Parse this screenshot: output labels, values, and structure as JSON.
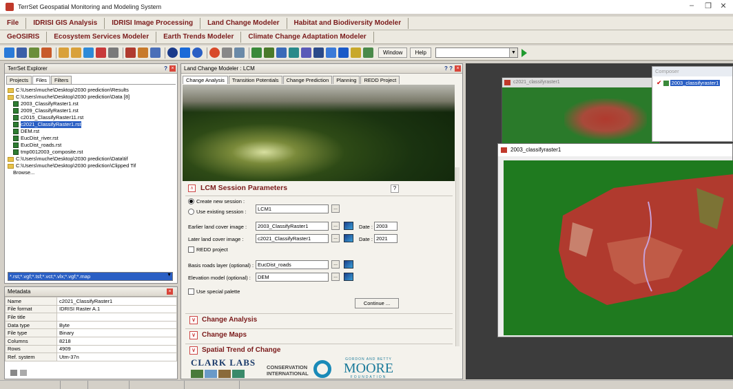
{
  "window": {
    "title": "TerrSet Geospatial Monitoring and Modeling System"
  },
  "menu1": [
    "File",
    "IDRISI GIS Analysis",
    "IDRISI Image Processing",
    "Land Change Modeler",
    "Habitat and Biodiversity Modeler"
  ],
  "menu2": [
    "GeOSIRIS",
    "Ecosystem Services Modeler",
    "Earth Trends Modeler",
    "Climate Change Adaptation Modeler"
  ],
  "toolbar": {
    "window_label": "Window",
    "help_label": "Help"
  },
  "explorer": {
    "title": "TerrSet Explorer",
    "help": "?",
    "tabs": [
      "Projects",
      "Files",
      "Filters"
    ],
    "tree": [
      {
        "icon": "folder",
        "text": "C:\\Users\\muche\\Desktop\\2030 prediction\\Results",
        "indent": 0
      },
      {
        "icon": "folder",
        "text": "C:\\Users\\muche\\Desktop\\2030 prediction\\Data [8]",
        "indent": 0
      },
      {
        "icon": "raster",
        "text": "2003_ClassifyRaster1.rst",
        "indent": 1
      },
      {
        "icon": "raster",
        "text": "2009_ClassifyRaster1.rst",
        "indent": 1
      },
      {
        "icon": "raster",
        "text": "c2015_ClassifyRaster11.rst",
        "indent": 1
      },
      {
        "icon": "raster",
        "text": "c2021_ClassifyRaster1.rst",
        "indent": 1,
        "selected": true
      },
      {
        "icon": "raster",
        "text": "DEM.rst",
        "indent": 1
      },
      {
        "icon": "raster",
        "text": "EucDist_river.rst",
        "indent": 1
      },
      {
        "icon": "raster",
        "text": "EucDist_roads.rst",
        "indent": 1
      },
      {
        "icon": "raster",
        "text": "tmp0012003_composite.rst",
        "indent": 1
      },
      {
        "icon": "folder",
        "text": "C:\\Users\\muche\\Desktop\\2030 prediction\\Data\\tif",
        "indent": 0
      },
      {
        "icon": "folder",
        "text": "C:\\Users\\muche\\Desktop\\2030 prediction\\Clipped Tif",
        "indent": 0
      },
      {
        "icon": "none",
        "text": "Browse...",
        "indent": 1
      }
    ],
    "filter": "*.rst;*.vgf;*.tsf;*.vct;*.vlx;*.vgf;*.map"
  },
  "metadata": {
    "title": "Metadata",
    "rows": [
      [
        "Name",
        "c2021_ClassifyRaster1"
      ],
      [
        "File format",
        "IDRISI Raster A.1"
      ],
      [
        "File title",
        ""
      ],
      [
        "Data type",
        "Byte"
      ],
      [
        "File type",
        "Binary"
      ],
      [
        "Columns",
        "8218"
      ],
      [
        "Rows",
        "4909"
      ],
      [
        "Ref. system",
        "Utm-37n"
      ]
    ]
  },
  "lcm": {
    "title": "Land Change Modeler : LCM",
    "help": "? ?",
    "tabs": [
      "Change Analysis",
      "Transition Potentials",
      "Change Prediction",
      "Planning",
      "REDD Project"
    ],
    "session_header": "LCM Session Parameters",
    "help_btn": "?",
    "create_label": "Create new session :",
    "use_label": "Use existing session :",
    "session_name": "LCM1",
    "earlier_label": "Earlier land cover image :",
    "earlier_value": "2003_ClassifyRaster1",
    "later_label": "Later land cover image :",
    "later_value": "c2021_ClassifyRaster1",
    "date_label": "Date :",
    "date1": "2003",
    "date2": "2021",
    "redd_label": "REDD project",
    "roads_label": "Basis roads layer (optional) :",
    "roads_value": "EucDist_roads",
    "elev_label": "Elevation model (optional) :",
    "elev_value": "DEM",
    "palette_label": "Use special palette",
    "continue_label": "Continue ...",
    "dots": "...",
    "sections": [
      "Change Analysis",
      "Change Maps",
      "Spatial Trend of Change"
    ]
  },
  "logos": {
    "clark": "CLARK LABS",
    "conservation": "CONSERVATION",
    "international": "INTERNATIONAL",
    "gbm_top": "GORDON AND BETTY",
    "moore": "MOORE",
    "foundation": "FOUNDATION"
  },
  "viewer1": {
    "title": "c2021_classifyraster1"
  },
  "viewer2": {
    "title": "2003_classifyraster1"
  },
  "composer": {
    "title": "Composer",
    "layer": "2003_classifyraster1"
  },
  "colors": {
    "accent": "#7a1a1a",
    "green": "#1f7a1f",
    "red": "#b03a2e"
  }
}
